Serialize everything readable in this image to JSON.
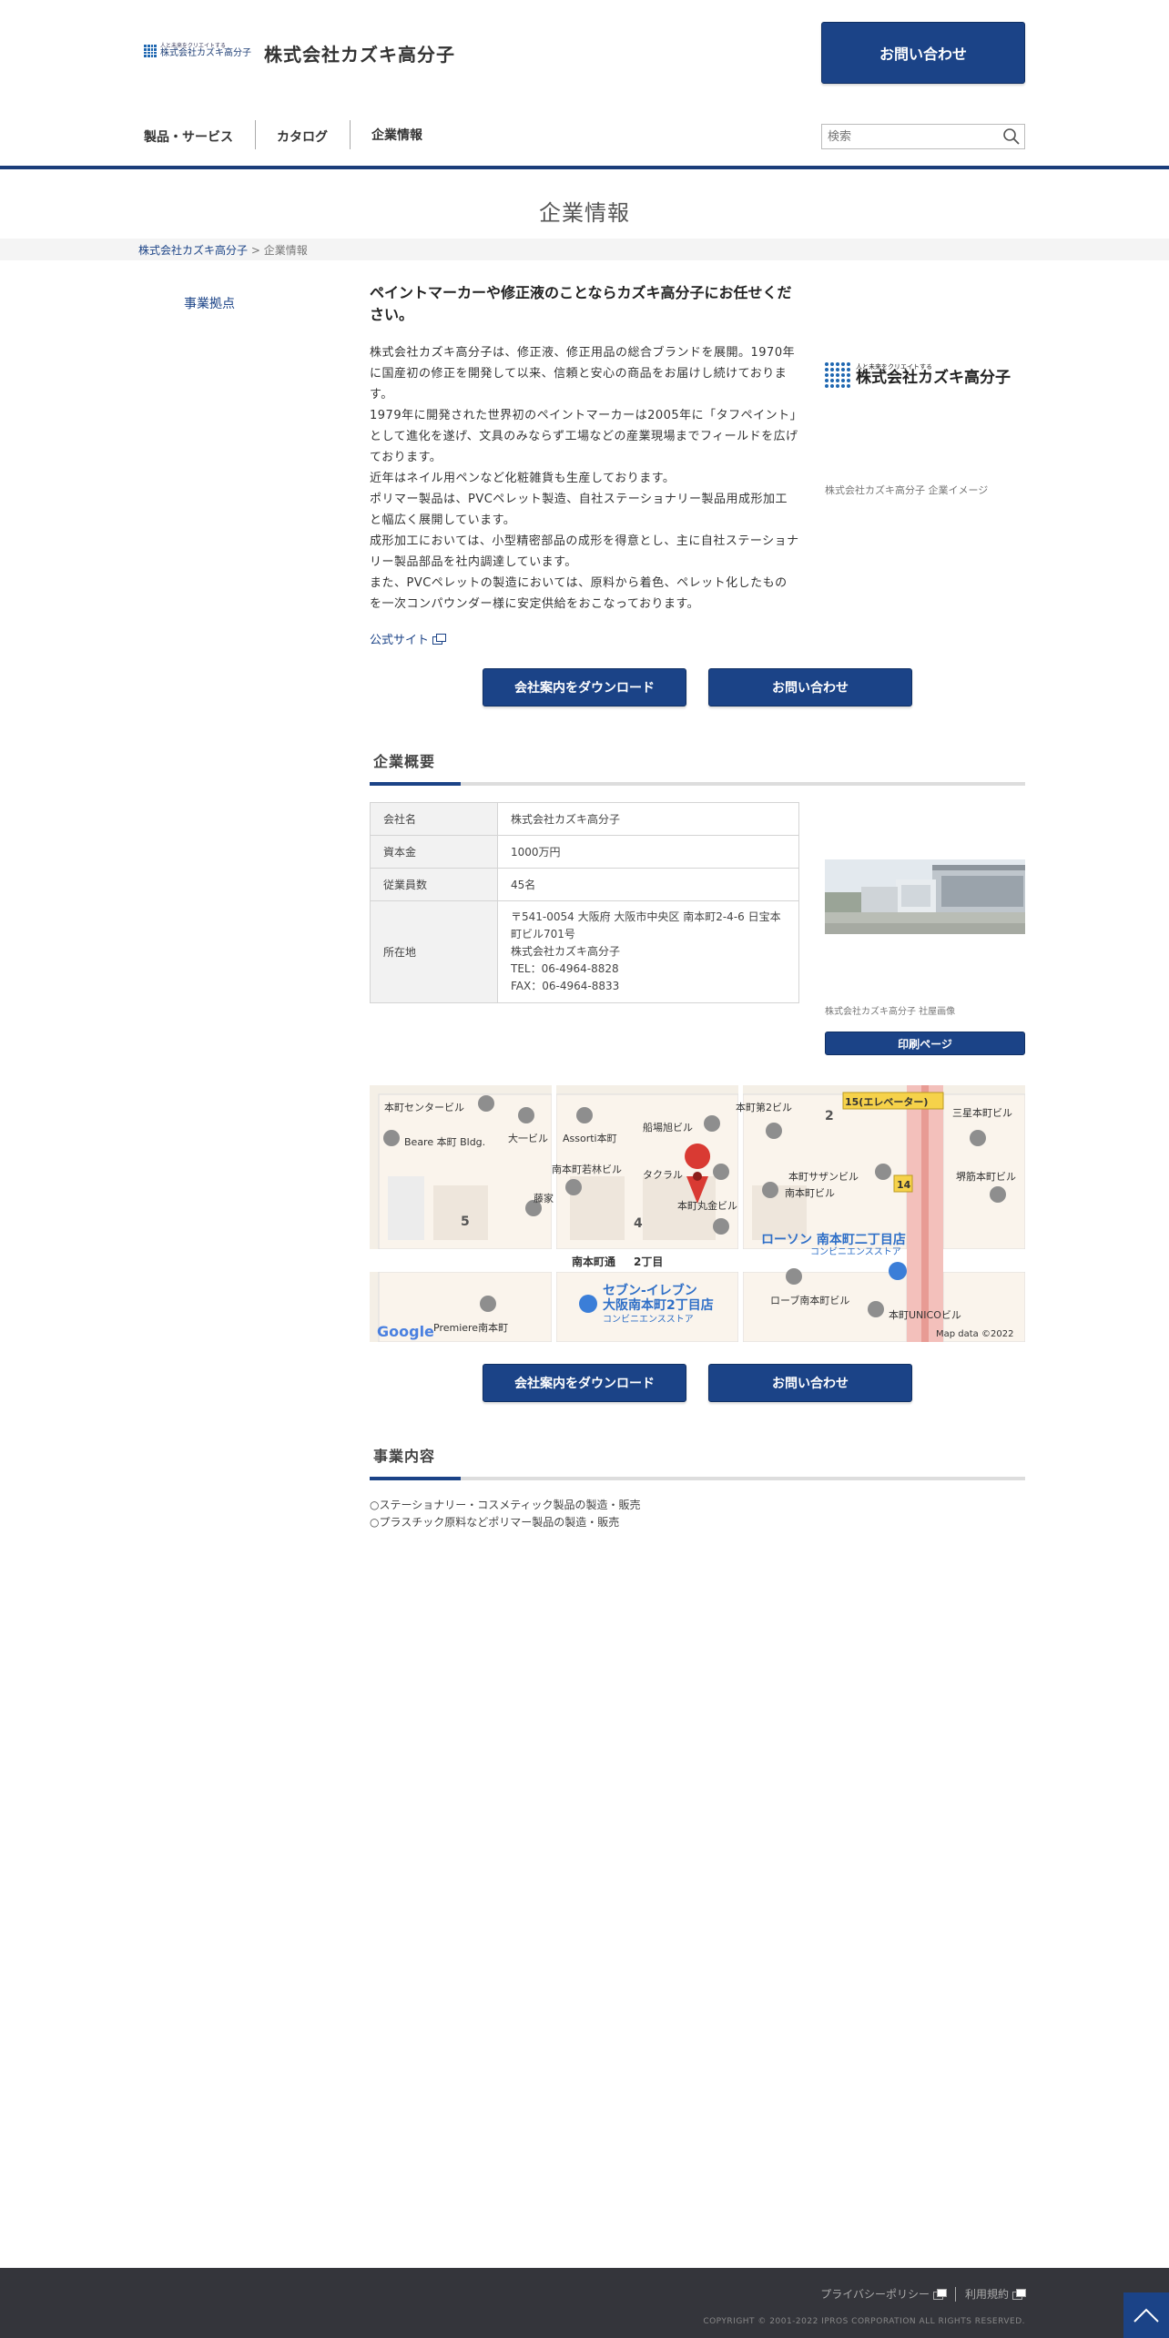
{
  "header": {
    "logo_tagline": "人と未来をクリエイトする",
    "logo_text": "株式会社カズキ高分子",
    "company_name": "株式会社カズキ高分子",
    "contact_label": "お問い合わせ",
    "nav": [
      {
        "label": "製品・サービス"
      },
      {
        "label": "カタログ"
      },
      {
        "label": "企業情報"
      }
    ],
    "search_placeholder": "検索"
  },
  "page_title": "企業情報",
  "breadcrumb": {
    "home": "株式会社カズキ高分子",
    "sep": " > ",
    "current": "企業情報"
  },
  "sidebar": {
    "link": "事業拠点"
  },
  "intro": {
    "heading": "ペイントマーカーや修正液のことならカズキ高分子にお任せください。",
    "paragraphs": [
      "株式会社カズキ高分子は、修正液、修正用品の総合ブランドを展開。1970年に国産初の修正を開発して以来、信頼と安心の商品をお届けし続けております。",
      "1979年に開発された世界初のペイントマーカーは2005年に「タフペイント」として進化を遂げ、文具のみならず工場などの産業現場までフィールドを広げております。",
      "近年はネイル用ペンなど化粧雑貨も生産しております。",
      "ポリマー製品は、PVCペレット製造、自社ステーショナリー製品用成形加工と幅広く展開しています。",
      "成形加工においては、小型精密部品の成形を得意とし、主に自社ステーショナリー製品部品を社内調達しています。",
      "また、PVCペレットの製造においては、原料から着色、ペレット化したものを一次コンパウンダー様に安定供給をおこなっております。"
    ],
    "official_site": "公式サイト",
    "image_caption": "株式会社カズキ高分子 企業イメージ",
    "side_logo_tagline": "人と未来をクリエイトする",
    "side_logo_name": "株式会社カズキ高分子"
  },
  "buttons": {
    "download": "会社案内をダウンロード",
    "contact": "お問い合わせ",
    "print": "印刷ページ"
  },
  "overview": {
    "title": "企業概要",
    "rows": [
      {
        "label": "会社名",
        "value": "株式会社カズキ高分子"
      },
      {
        "label": "資本金",
        "value": "1000万円"
      },
      {
        "label": "従業員数",
        "value": "45名"
      }
    ],
    "address_label": "所在地",
    "address_lines": [
      "〒541-0054 大阪府 大阪市中央区 南本町2-4-6 日宝本町ビル701号",
      "株式会社カズキ高分子",
      "TEL：06-4964-8828",
      "FAX：06-4964-8833"
    ],
    "photo_caption": "株式会社カズキ高分子 社屋画像"
  },
  "map": {
    "labels": {
      "l1": "本町センタービル",
      "l2": "Beare 本町 Bldg.",
      "l3": "大一ビル",
      "l4": "Assorti本町",
      "l5": "船場旭ビル",
      "l6": "本町第2ビル",
      "l7": "15(エレベーター)",
      "l8": "三星本町ビル",
      "l9": "南本町若林ビル",
      "l10": "タクラル",
      "l11": "本町丸金ビル",
      "l12": "本町サザンビル",
      "l13": "南本町ビル",
      "l14": "堺筋本町ビル",
      "l15": "藤家",
      "l16": "ローソン 南本町二丁目店",
      "l17": "コンビニエンスストア",
      "l18": "南本町通",
      "l19": "2丁目",
      "l20": "セブン-イレブン",
      "l21": "大阪南本町2丁目店",
      "l22": "コンビニエンスストア",
      "l23": "ローブ南本町ビル",
      "l24": "本町UNICOビル",
      "l25": "Premiere南本町",
      "l26": "Map data ©2022",
      "l27": "Google",
      "b5": "5",
      "b4": "4",
      "b2": "2",
      "b14": "14"
    }
  },
  "business": {
    "title": "事業内容",
    "items": [
      "○ステーショナリー・コスメティック製品の製造・販売",
      "○プラスチック原料などポリマー製品の製造・販売"
    ]
  },
  "footer": {
    "privacy": "プライバシーポリシー",
    "terms": "利用規約",
    "copyright": "COPYRIGHT © 2001-2022 IPROS CORPORATION ALL RIGHTS RESERVED."
  },
  "colors": {
    "brand": "#1b4387",
    "accent_line": "#1b3d7a",
    "footer_bg": "#34353b"
  }
}
